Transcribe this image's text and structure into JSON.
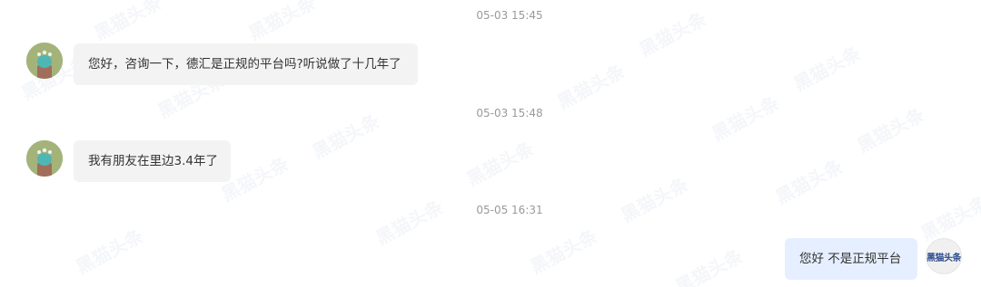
{
  "messages": [
    {
      "timestamp": "05-03 15:45",
      "sender": "other",
      "text": "您好，咨询一下，德汇是正规的平台吗?听说做了十几年了"
    },
    {
      "timestamp": "05-03 15:48",
      "sender": "other",
      "text": "我有朋友在里边3.4年了"
    },
    {
      "timestamp": "05-05 16:31",
      "sender": "self",
      "text": "您好 不是正规平台"
    }
  ],
  "self_avatar_text": "黑猫头条",
  "watermark_text": "黑猫头条",
  "colors": {
    "incoming_bubble": "#f3f3f3",
    "outgoing_bubble": "#e6efff",
    "timestamp": "#9a9a9a",
    "avatar_incoming": "#a4b37a"
  },
  "icons": {
    "incoming_avatar": "user-avatar-icon",
    "outgoing_avatar": "brand-logo-avatar"
  }
}
